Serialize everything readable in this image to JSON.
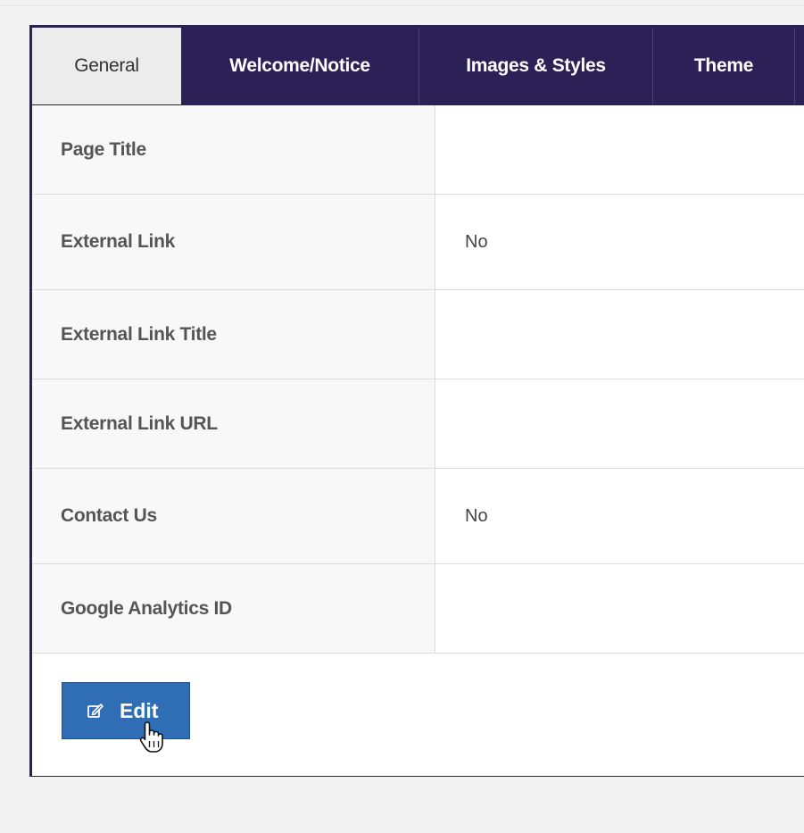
{
  "tabs": [
    {
      "label": "General",
      "active": true
    },
    {
      "label": "Welcome/Notice",
      "active": false
    },
    {
      "label": "Images & Styles",
      "active": false
    },
    {
      "label": "Theme",
      "active": false
    },
    {
      "label": "",
      "active": false
    }
  ],
  "rows": [
    {
      "label": "Page Title",
      "value": ""
    },
    {
      "label": "External Link",
      "value": "No"
    },
    {
      "label": "External Link Title",
      "value": ""
    },
    {
      "label": "External Link URL",
      "value": ""
    },
    {
      "label": "Contact Us",
      "value": "No"
    },
    {
      "label": "Google Analytics ID",
      "value": ""
    }
  ],
  "actions": {
    "edit_label": "Edit",
    "edit_icon": "pencil-square-icon",
    "cursor_icon": "hand-pointer-icon"
  },
  "colors": {
    "tab_bar": "#2b2157",
    "active_tab": "#ececec",
    "edit_button": "#2f6db4",
    "label_cell": "#f8f8f8",
    "page_bg": "#f3f3f3"
  }
}
